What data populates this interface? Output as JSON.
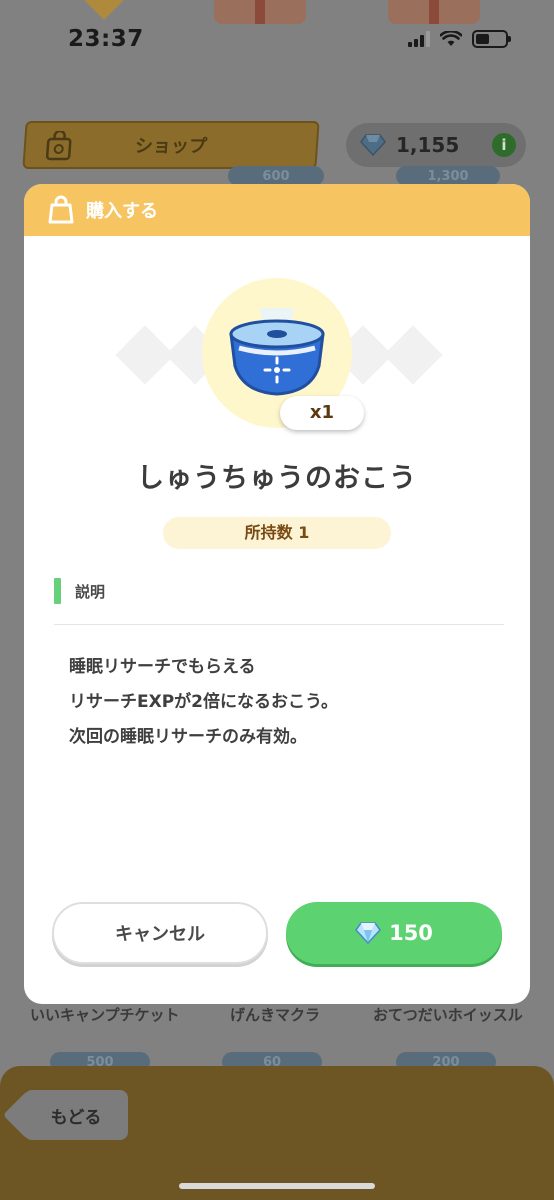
{
  "status_bar": {
    "time": "23:37"
  },
  "background": {
    "shop_tab_label": "ショップ",
    "gem_balance": "1,155",
    "info_label": "i",
    "top_prices": [
      "600",
      "1,300"
    ],
    "items": [
      {
        "name": "いいキャンプチケット",
        "price": "500"
      },
      {
        "name": "げんきマクラ",
        "price": "60"
      },
      {
        "name": "おてつだいホイッスル",
        "price": "200"
      }
    ],
    "back_label": "もどる"
  },
  "modal": {
    "title": "購入する",
    "item_icon": "incense-icon",
    "quantity": "x1",
    "item_name": "しゅうちゅうのおこう",
    "owned": "所持数 1",
    "description_label": "説明",
    "description_lines": [
      "睡眠リサーチでもらえる",
      "リサーチEXPが2倍になるおこう。",
      "次回の睡眠リサーチのみ有効。"
    ],
    "cancel_label": "キャンセル",
    "buy_price": "150"
  },
  "colors": {
    "header": "#f6c561",
    "buy_button": "#5dd271",
    "desc_accent": "#66d17a",
    "owned_pill": "#fdf4d6"
  }
}
